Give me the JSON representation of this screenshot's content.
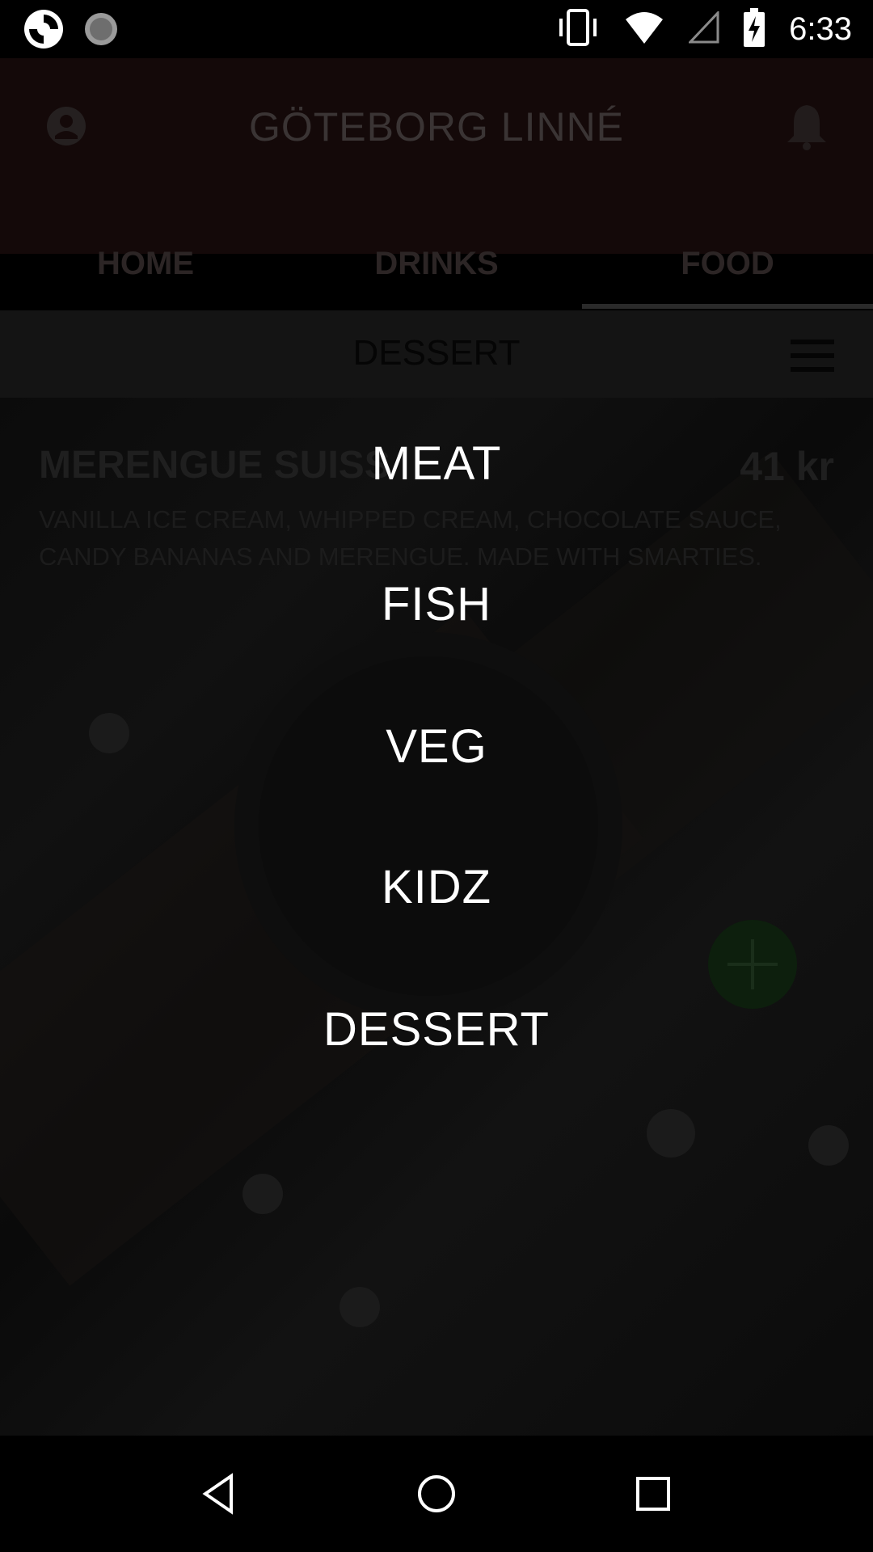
{
  "status_bar": {
    "time": "6:33",
    "icons": [
      "app-logo-icon",
      "loading-icon",
      "vibrate-icon",
      "wifi-icon",
      "signal-icon",
      "battery-charging-icon"
    ]
  },
  "header": {
    "title": "GÖTEBORG LINNÉ",
    "tabs": [
      {
        "label": "HOME"
      },
      {
        "label": "DRINKS"
      },
      {
        "label": "FOOD"
      }
    ],
    "selected_tab": "FOOD"
  },
  "category_bar": {
    "label": "DESSERT"
  },
  "menu_item": {
    "title": "MERENGUE SUISS",
    "price": "41 kr",
    "description": "VANILLA ICE CREAM, WHIPPED CREAM, CHOCOLATE SAUCE, CANDY BANANAS AND MERENGUE. MADE WITH SMARTIES."
  },
  "category_menu": {
    "items": [
      "MEAT",
      "FISH",
      "VEG",
      "KIDZ",
      "DESSERT"
    ]
  },
  "colors": {
    "overlay_text": "#ffffff",
    "header_bg": "#140909"
  }
}
